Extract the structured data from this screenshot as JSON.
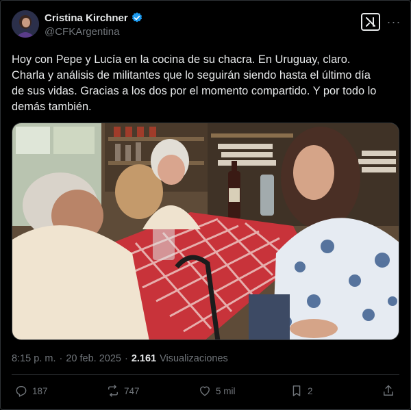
{
  "author": {
    "display_name": "Cristina Kirchner",
    "handle": "@CFKArgentina",
    "verified": true
  },
  "tweet": {
    "text": "Hoy con Pepe y Lucía en la cocina de su chacra. En Uruguay, claro.\nCharla y análisis de militantes que lo seguirán siendo hasta el último día\nde sus vidas. Gracias a los dos por el momento compartido. Y por todo lo\ndemás también.",
    "time": "8:15 p. m.",
    "separator": "·",
    "date": "20 feb. 2025",
    "views_count": "2.161",
    "views_label": "Visualizaciones"
  },
  "actions": {
    "replies": "187",
    "reposts": "747",
    "likes": "5 mil",
    "bookmarks": "2"
  },
  "icons": {
    "verified": "verified-badge-icon",
    "grok": "grok-icon",
    "more": "more-icon",
    "reply": "reply-icon",
    "repost": "repost-icon",
    "like": "heart-icon",
    "bookmark": "bookmark-icon",
    "share": "share-icon"
  },
  "colors": {
    "background": "#000000",
    "text": "#e7e9ea",
    "muted": "#71767b",
    "verified": "#1d9bf0",
    "border": "#2f3336"
  }
}
